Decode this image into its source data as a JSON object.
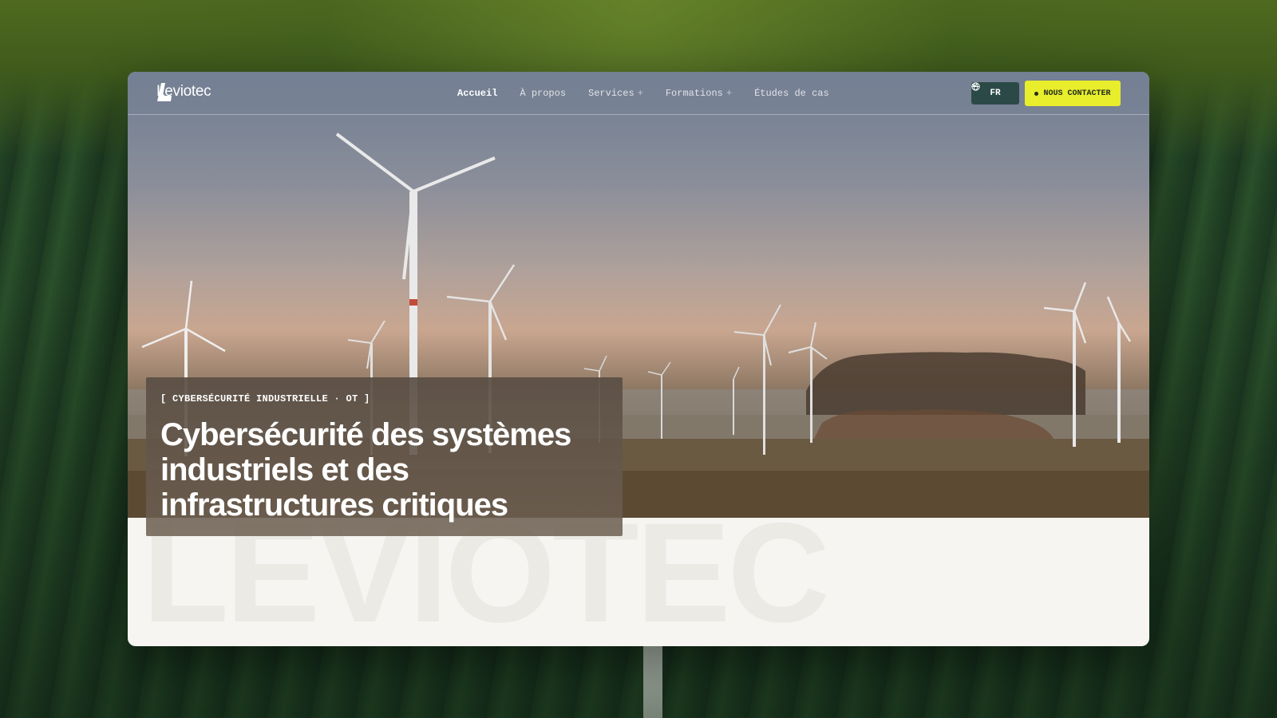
{
  "brand": {
    "name": "Leviotec"
  },
  "nav": {
    "items": [
      {
        "label": "Accueil",
        "active": true,
        "has_submenu": false
      },
      {
        "label": "À propos",
        "active": false,
        "has_submenu": false
      },
      {
        "label": "Services",
        "active": false,
        "has_submenu": true
      },
      {
        "label": "Formations",
        "active": false,
        "has_submenu": true
      },
      {
        "label": "Études de cas",
        "active": false,
        "has_submenu": false
      }
    ],
    "submenu_symbol": "+"
  },
  "language": {
    "selected": "FR",
    "icon": "globe-icon"
  },
  "cta": {
    "label": "NOUS CONTACTER",
    "color": "#e8ed2c"
  },
  "hero": {
    "eyebrow": "[ CYBERSÉCURITÉ INDUSTRIELLE · OT ]",
    "headline": "Cybersécurité des systèmes industriels et des infrastructures critiques"
  },
  "watermark": {
    "text": "LEVIOTEC"
  },
  "colors": {
    "accent": "#e8ed2c",
    "lang_button": "#2b4a47",
    "page_bg": "#f6f5f2"
  }
}
